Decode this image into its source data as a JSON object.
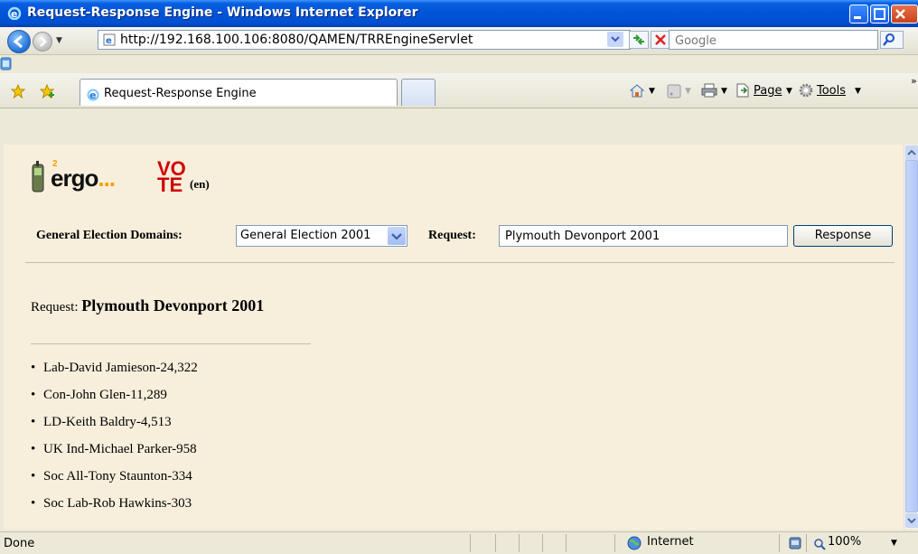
{
  "window": {
    "title": "Request-Response Engine - Windows Internet Explorer"
  },
  "address": {
    "url": "http://192.168.100.106:8080/QAMEN/TRREngineServlet"
  },
  "search": {
    "placeholder": "Google"
  },
  "tabs": [
    {
      "label": "Request-Response Engine"
    }
  ],
  "commands": {
    "page": "Page",
    "tools": "Tools"
  },
  "logo": {
    "ergo": "ergo",
    "dots": "...",
    "vote_top": "VO",
    "vote_bottom": "TE",
    "lang": "(en)",
    "sup": "2"
  },
  "form": {
    "domains_label": "General Election Domains:",
    "domain_selected": "General Election 2001",
    "request_label": "Request:",
    "request_value": "Plymouth Devonport 2001",
    "response_button": "Response"
  },
  "result": {
    "request_prefix": "Request:",
    "request_title": "Plymouth Devonport 2001",
    "items": [
      "Lab-David Jamieson-24,322",
      "Con-John Glen-11,289",
      "LD-Keith Baldry-4,513",
      "UK Ind-Michael Parker-958",
      "Soc All-Tony Staunton-334",
      "Soc Lab-Rob Hawkins-303"
    ]
  },
  "status": {
    "text": "Done",
    "zone": "Internet",
    "zoom": "100%"
  }
}
